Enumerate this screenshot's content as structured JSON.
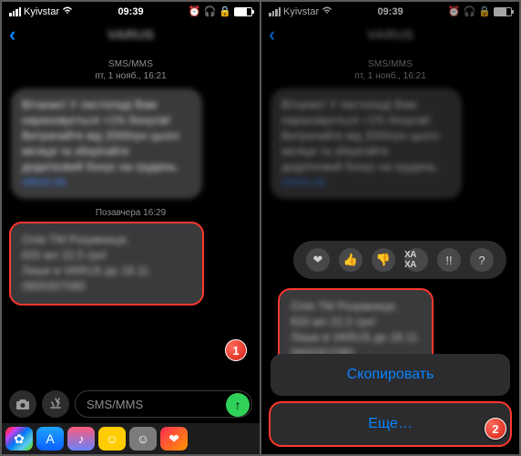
{
  "status": {
    "carrier": "Kyivstar",
    "time": "09:39"
  },
  "header": {
    "title_blurred": "VARUS"
  },
  "labels": {
    "sms_type": "SMS/MMS",
    "date1": "пт, 1 нояб., 16:21",
    "date2": "Позавчера 16:29"
  },
  "bubble1_blurred": "Вітаємо! У листопаді Вам нараховується +1% бонусів! Витрачайте від 2000грн цього місяця та зберігайте додатковий бонус на грудень.",
  "bubble2": {
    "line1_blurred": "Олія ТМ Розумниця,",
    "line2_blurred": "820 мл  22,5 грн!",
    "line3_blurred": "Лише в VARUS до 18.11.",
    "link_blurred": "0800307080"
  },
  "input": {
    "placeholder": "SMS/MMS"
  },
  "reactions": {
    "heart": "❤",
    "up": "👍",
    "down": "👎",
    "haha": "XA XA",
    "bang": "!!",
    "q": "?"
  },
  "actions": {
    "copy": "Скопировать",
    "more": "Еще…"
  },
  "badges": {
    "one": "1",
    "two": "2"
  }
}
